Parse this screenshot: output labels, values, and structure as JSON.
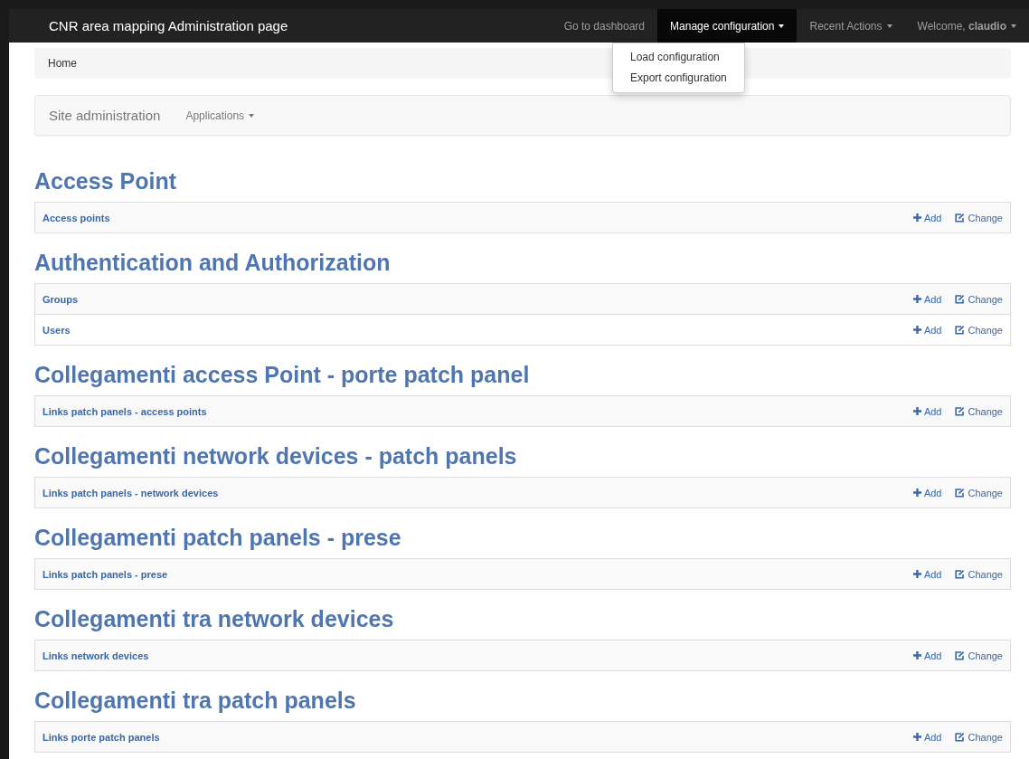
{
  "navbar": {
    "brand": "CNR area mapping Administration page",
    "items": [
      {
        "label": "Go to dashboard",
        "has_caret": false,
        "selected": false
      },
      {
        "label": "Manage configuration",
        "has_caret": true,
        "selected": true
      },
      {
        "label": "Recent Actions",
        "has_caret": true,
        "selected": false
      },
      {
        "label": "Welcome, **claudio**",
        "has_caret": true,
        "selected": false
      }
    ],
    "dropdown": [
      "Load configuration",
      "Export configuration"
    ]
  },
  "breadcrumb": "Home",
  "subnav": {
    "title": "Site administration",
    "menu": "Applications"
  },
  "sections": [
    {
      "title": "Access Point",
      "models": [
        {
          "name": "Access points",
          "add": "Add",
          "change": "Change"
        }
      ]
    },
    {
      "title": "Authentication and Authorization",
      "models": [
        {
          "name": "Groups",
          "add": "Add",
          "change": "Change"
        },
        {
          "name": "Users",
          "add": "Add",
          "change": "Change"
        }
      ]
    },
    {
      "title": "Collegamenti access Point - porte patch panel",
      "models": [
        {
          "name": "Links patch panels - access points",
          "add": "Add",
          "change": "Change"
        }
      ]
    },
    {
      "title": "Collegamenti network devices - patch panels",
      "models": [
        {
          "name": "Links patch panels - network devices",
          "add": "Add",
          "change": "Change"
        }
      ]
    },
    {
      "title": "Collegamenti patch panels - prese",
      "models": [
        {
          "name": "Links patch panels - prese",
          "add": "Add",
          "change": "Change"
        }
      ]
    },
    {
      "title": "Collegamenti tra network devices",
      "models": [
        {
          "name": "Links network devices",
          "add": "Add",
          "change": "Change"
        }
      ]
    },
    {
      "title": "Collegamenti tra patch panels",
      "models": [
        {
          "name": "Links porte patch panels",
          "add": "Add",
          "change": "Change"
        }
      ]
    }
  ]
}
